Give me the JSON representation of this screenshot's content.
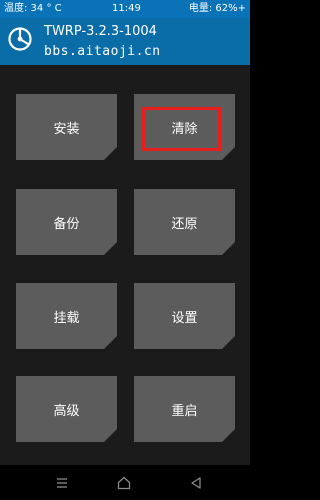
{
  "status_bar": {
    "temperature": "温度: 34 ° C",
    "time": "11:49",
    "battery": "电量: 62%+"
  },
  "header": {
    "title": "TWRP-3.2.3-1004",
    "subtitle": "bbs.aitaoji.cn"
  },
  "menu": {
    "install": "安装",
    "wipe": "清除",
    "backup": "备份",
    "restore": "还原",
    "mount": "挂载",
    "settings": "设置",
    "advanced": "高级",
    "reboot": "重启"
  },
  "colors": {
    "status_bar": "#0a72b6",
    "header": "#0b6da8",
    "tile": "#5c5c5c",
    "background": "#1b1b1b",
    "highlight": "#e61e1e"
  },
  "icons": {
    "logo": "twrp-logo",
    "nav_menu": "menu-icon",
    "nav_home": "home-icon",
    "nav_back": "back-icon"
  }
}
